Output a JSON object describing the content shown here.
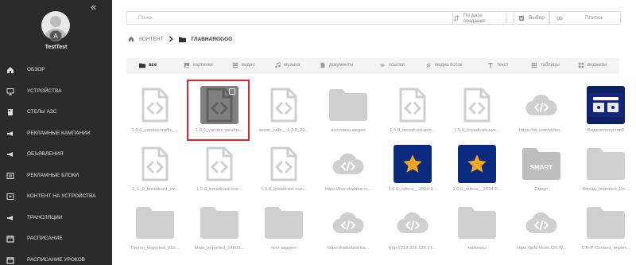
{
  "sidebar": {
    "collapse_icon": "double-chevron-left-icon",
    "avatar_badge": "A",
    "username": "TestTest",
    "items": [
      {
        "label": "ОБЗОР",
        "icon": "home-icon"
      },
      {
        "label": "УСТРОЙСТВА",
        "icon": "monitor-icon"
      },
      {
        "label": "СТЕЛЫ АЗС",
        "icon": "stela-icon"
      },
      {
        "label": "РЕКЛАМНЫЕ КАМПАНИИ",
        "icon": "campaign-icon"
      },
      {
        "label": "ОБЪЯВЛЕНИЯ",
        "icon": "megaphone-icon"
      },
      {
        "label": "РЕКЛАМНЫЕ БЛОКИ",
        "icon": "blocks-icon"
      },
      {
        "label": "КОНТЕНТ НА УСТРОЙСТВА",
        "icon": "screen-content-icon"
      },
      {
        "label": "ТРАНСЛЯЦИИ",
        "icon": "broadcast-icon"
      },
      {
        "label": "РАСПИСАНИЕ",
        "icon": "calendar-icon"
      },
      {
        "label": "РАСПИСАНИЕ УРОКОВ",
        "icon": "calendar-icon"
      }
    ]
  },
  "toolbar": {
    "search_placeholder": "Поиск",
    "sort_label": "По дате создания",
    "select_label": "Выбор",
    "view_label": "Плитка"
  },
  "breadcrumb": {
    "root": "КОНТЕНТ",
    "current": "ГЛАВНАЯGGGG"
  },
  "tabs": [
    {
      "label": "все",
      "icon": "folder-icon",
      "active": true
    },
    {
      "label": "картинки",
      "icon": "image-icon",
      "active": false
    },
    {
      "label": "видео",
      "icon": "video-icon",
      "active": false
    },
    {
      "label": "музыка",
      "icon": "music-icon",
      "active": false
    },
    {
      "label": "документы",
      "icon": "document-icon",
      "active": false
    },
    {
      "label": "ссылки",
      "icon": "link-icon",
      "active": false
    },
    {
      "label": "медиа поток",
      "icon": "stream-icon",
      "active": false
    },
    {
      "label": "текст",
      "icon": "text-icon",
      "active": false
    },
    {
      "label": "таблицы",
      "icon": "table-icon",
      "active": false
    },
    {
      "label": "виджеты",
      "icon": "widget-icon",
      "active": false
    }
  ],
  "grid": [
    [
      {
        "name": "1.0.0_yandex-traffic_...",
        "kind": "code"
      },
      {
        "name": "1.0.0_yandex-weathe...",
        "kind": "code",
        "selected": true
      },
      {
        "name": "aeron_cafe__1.1.0_20...",
        "kind": "code"
      },
      {
        "name": "выставка.медия",
        "kind": "folder"
      },
      {
        "name": "1.5.0_broadcast-eve...",
        "kind": "code"
      },
      {
        "name": "1.5.0_broadcast-eve...",
        "kind": "code"
      },
      {
        "name": "https://vk.com/video...",
        "kind": "link"
      },
      {
        "name": "Видеоплеер.mp4",
        "kind": "video-thumb"
      }
    ],
    [
      {
        "name": "1_1_0_broadcast_ev...",
        "kind": "code"
      },
      {
        "name": "1.5.0_broadcast-eve...",
        "kind": "code"
      },
      {
        "name": "1.5.0_broadcast-eve...",
        "kind": "code"
      },
      {
        "name": "https://live.vkvideo.ru...",
        "kind": "link"
      },
      {
        "name": "1.0.0_orleca__2024-0...",
        "kind": "star"
      },
      {
        "name": "1.0.0_orleca__2024-0...",
        "kind": "star"
      },
      {
        "name": "Смарт",
        "kind": "smart",
        "thumb_text": "SMART"
      },
      {
        "name": "Фасад_imported_De...",
        "kind": "folder"
      }
    ],
    [
      {
        "name": "Пилон_imported_01b...",
        "kind": "folder"
      },
      {
        "name": "Main_imported_14b05...",
        "kind": "folder"
      },
      {
        "name": "тест виджет",
        "kind": "folder"
      },
      {
        "name": "https://radiobzd-ba...",
        "kind": "link"
      },
      {
        "name": "http://213.226.126.17...",
        "kind": "link"
      },
      {
        "name": "таймеры",
        "kind": "folder"
      },
      {
        "name": "https://info-kiosk.CK.W...",
        "kind": "link"
      },
      {
        "name": "CTFP Content_import...",
        "kind": "folder"
      }
    ]
  ],
  "colors": {
    "sidebar_bg": "#2b2b2b",
    "selection_border": "#e0262b",
    "icon_gray": "#cfcfcf",
    "star_bg": "#0a2a80",
    "star": "#f5a623"
  }
}
